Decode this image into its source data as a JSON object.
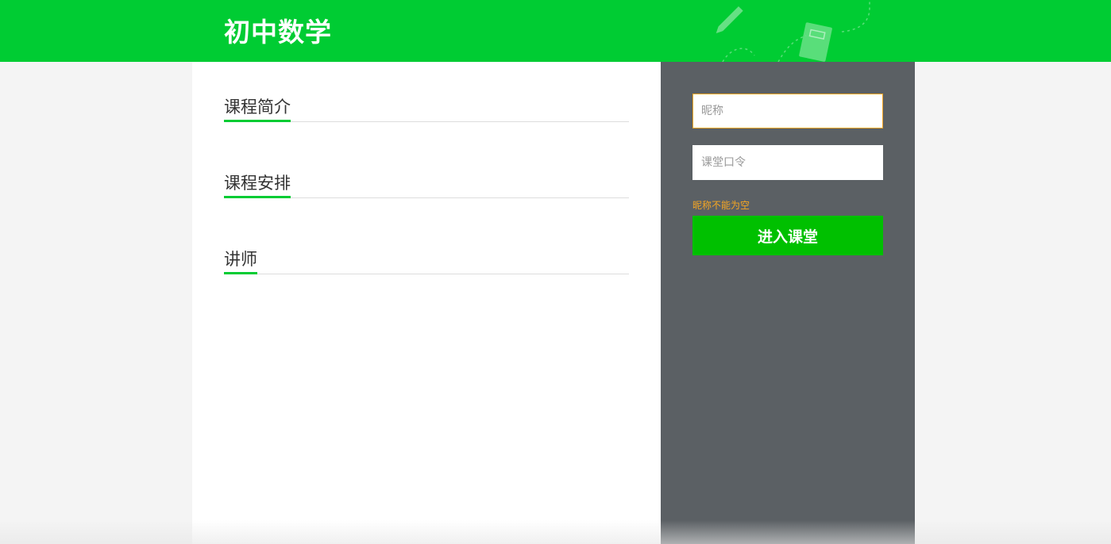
{
  "header": {
    "title": "初中数学",
    "deco_icons": [
      "pencil-icon",
      "notebook-icon"
    ],
    "bg_color": "#00cc33"
  },
  "main": {
    "sections": [
      {
        "title": "课程简介"
      },
      {
        "title": "课程安排"
      },
      {
        "title": "讲师"
      }
    ],
    "accent_color": "#00cc33"
  },
  "sidebar": {
    "nickname_placeholder": "昵称",
    "nickname_value": "",
    "code_placeholder": "课堂口令",
    "code_value": "",
    "error_text": "昵称不能为空",
    "enter_button_label": "进入课堂",
    "bg_color": "#5b6064",
    "error_color": "#f5a623"
  }
}
